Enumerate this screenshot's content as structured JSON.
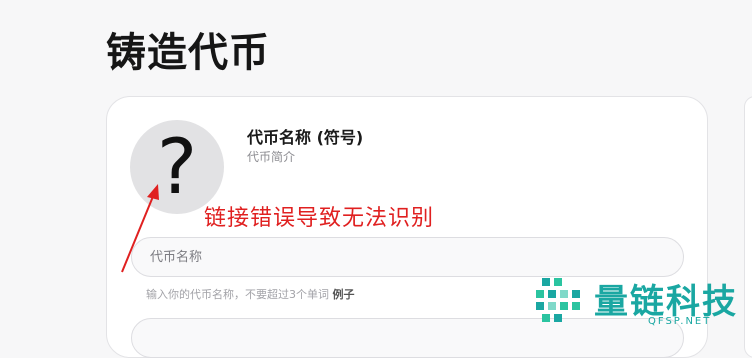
{
  "page": {
    "title": "铸造代币"
  },
  "token": {
    "avatar_glyph": "?",
    "name": "代币名称 (符号)",
    "description": "代币简介"
  },
  "annotation": {
    "text": "链接错误导致无法识别",
    "color": "#e02020"
  },
  "form": {
    "name_placeholder": "代币名称",
    "name_value": "",
    "helper_text": "输入你的代币名称，不要超过3个单词",
    "helper_example": "例子"
  },
  "watermark": {
    "brand": "量链科技",
    "domain": "QFSP.NET",
    "color": "#1aa7a2"
  }
}
